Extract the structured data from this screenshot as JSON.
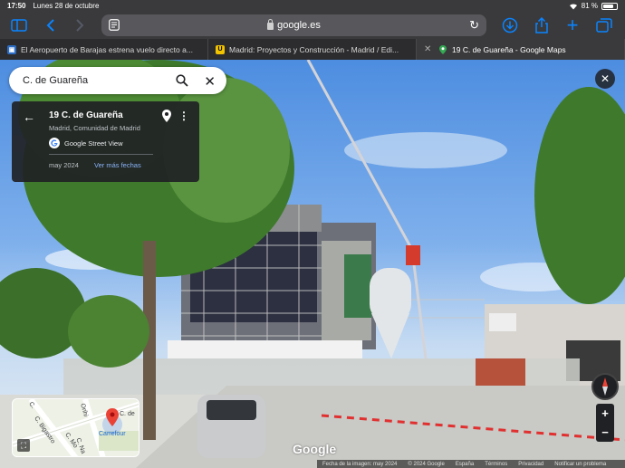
{
  "status": {
    "time": "17:50",
    "date": "Lunes 28 de octubre",
    "battery": "81 %",
    "battery_level": 0.81
  },
  "toolbar": {
    "url": "google.es"
  },
  "tabs": [
    {
      "label": "El Aeropuerto de Barajas estrena vuelo directo a...",
      "fav": ""
    },
    {
      "label": "Madrid: Proyectos y Construcción - Madrid / Edi...",
      "fav": "U"
    },
    {
      "label": "19 C. de Guareña - Google Maps",
      "fav": ""
    }
  ],
  "search": {
    "value": "C. de Guareña"
  },
  "card": {
    "title": "19 C. de Guareña",
    "subtitle": "Madrid, Comunidad de Madrid",
    "source": "Google Street View",
    "date": "may 2024",
    "more_dates": "Ver más fechas"
  },
  "minimap": {
    "labels": [
      "C. de",
      "Carrefour",
      "C. Bigastro",
      "Orihi",
      "C. Mo",
      "C. Na",
      "C."
    ]
  },
  "zoom": {
    "plus": "+",
    "minus": "−"
  },
  "logo": "Google",
  "footer": {
    "imagery_date": "Fecha de la imagen: may 2024",
    "copyright": "© 2024 Google",
    "country": "España",
    "terms": "Términos",
    "privacy": "Privacidad",
    "report": "Notificar un problema"
  },
  "colors": {
    "accent": "#0a84ff",
    "maps_link": "#8ab4f8",
    "pin": "#ea4335"
  }
}
